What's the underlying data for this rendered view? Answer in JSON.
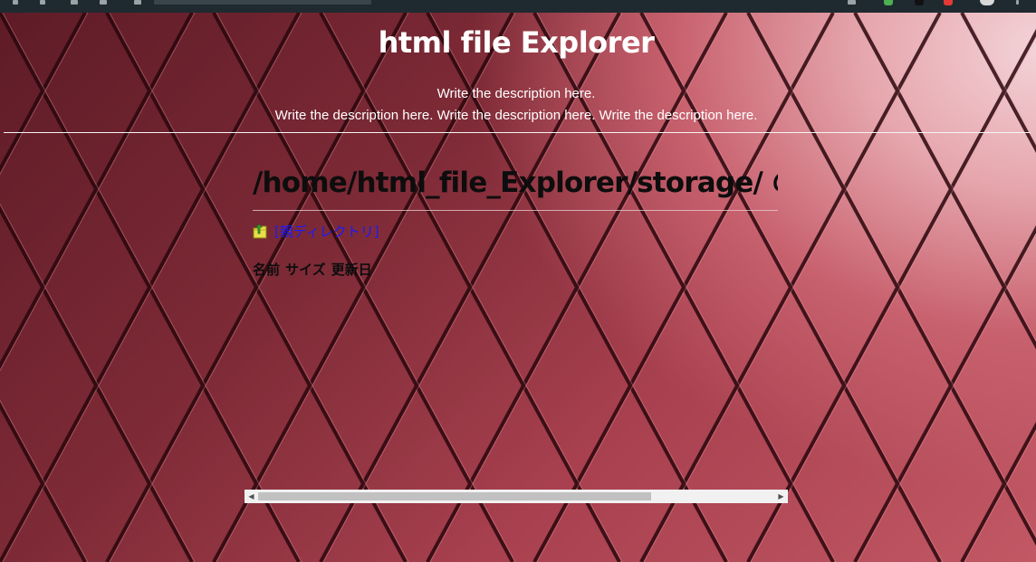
{
  "header": {
    "title": "html file Explorer",
    "description_line1": "Write the description here.",
    "description_line2": "Write the description here. Write the description here. Write the description here."
  },
  "main": {
    "path_heading": "/home/html_file_Explorer/storage/ の",
    "parent_link_label": "[親ディレクトリ]",
    "parent_icon": "folder-up-icon",
    "table": {
      "columns": [
        "名前",
        "サイズ",
        "更新日"
      ],
      "rows": []
    }
  },
  "scrollbar": {
    "position_fraction": 0
  },
  "colors": {
    "title_text": "#ffffff",
    "heading_text": "#0d0d0d",
    "link": "#1a1aff",
    "background_accent": "#a8404f"
  }
}
